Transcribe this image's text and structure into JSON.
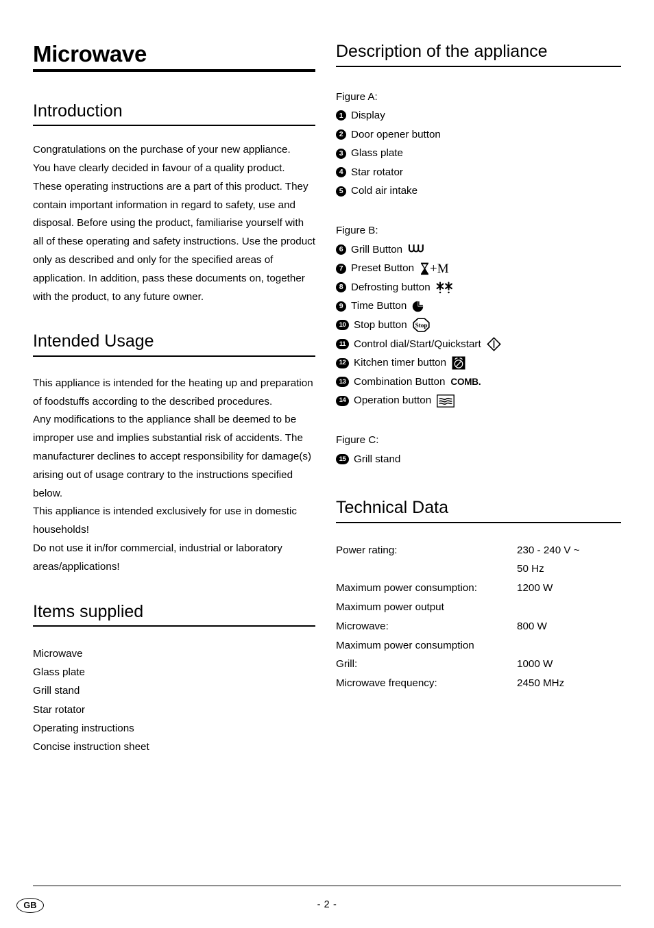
{
  "document": {
    "title": "Microwave"
  },
  "left_column": {
    "introduction": {
      "heading": "Introduction",
      "paragraphs": [
        "Congratulations on the purchase of your new appliance.",
        "You have clearly decided in favour of a quality product. These operating instructions are a part of this product. They contain important information in regard to safety, use and disposal. Before using the product, familiarise yourself with all of these operating and safety instructions. Use the product only as described and only for the specified areas of application. In addition, pass these documents on, together with the product, to any future owner."
      ]
    },
    "intended_usage": {
      "heading": "Intended Usage",
      "paragraphs": [
        "This appliance is intended for the heating up and preparation of foodstuffs according to the described procedures.",
        "Any modifications to the appliance shall be deemed to be improper use and implies substantial risk of accidents. The manufacturer declines to accept responsibility for damage(s) arising out of usage contrary to the instructions specified below.",
        "This appliance is intended exclusively for use in domestic households!",
        "Do not use it in/for commercial, industrial or laboratory areas/applications!"
      ]
    },
    "items_supplied": {
      "heading": "Items supplied",
      "items": [
        "Microwave",
        "Glass plate",
        "Grill stand",
        "Star rotator",
        "Operating instructions",
        "Concise instruction sheet"
      ]
    }
  },
  "right_column": {
    "description": {
      "heading": "Description of the appliance",
      "figure_a": {
        "label": "Figure A:",
        "items": [
          {
            "number": "1",
            "label": "Display",
            "icon": ""
          },
          {
            "number": "2",
            "label": "Door opener button",
            "icon": ""
          },
          {
            "number": "3",
            "label": "Glass plate",
            "icon": ""
          },
          {
            "number": "4",
            "label": "Star rotator",
            "icon": ""
          },
          {
            "number": "5",
            "label": "Cold air intake",
            "icon": ""
          }
        ]
      },
      "figure_b": {
        "label": "Figure B:",
        "items": [
          {
            "number": "6",
            "label": "Grill Button",
            "icon": "grill-element-icon"
          },
          {
            "number": "7",
            "label": "Preset Button",
            "icon": "hourglass-plus-m-icon"
          },
          {
            "number": "8",
            "label": "Defrosting button",
            "icon": "snowflake-pair-icon"
          },
          {
            "number": "9",
            "label": "Time Button",
            "icon": "pie-clock-icon"
          },
          {
            "number": "10",
            "label": "Stop button",
            "icon": "stop-octagon-icon"
          },
          {
            "number": "11",
            "label": "Control dial/Start/Quickstart",
            "icon": "diamond-start-icon"
          },
          {
            "number": "12",
            "label": "Kitchen timer button",
            "icon": "alarm-clock-icon"
          },
          {
            "number": "13",
            "label": "Combination Button",
            "icon": "comb-text-icon",
            "icon_text": "COMB."
          },
          {
            "number": "14",
            "label": "Operation button",
            "icon": "microwave-waves-icon"
          }
        ]
      },
      "figure_c": {
        "label": "Figure C:",
        "items": [
          {
            "number": "15",
            "label": "Grill stand",
            "icon": ""
          }
        ]
      }
    },
    "technical_data": {
      "heading": "Technical Data",
      "rows": [
        {
          "label": "Power rating:",
          "value": "230 - 240 V ~"
        },
        {
          "label": "",
          "value": "50 Hz"
        },
        {
          "label": "Maximum power consumption:",
          "value": "1200 W"
        },
        {
          "label": "Maximum power output",
          "value": ""
        },
        {
          "label": "Microwave:",
          "value": "800 W"
        },
        {
          "label": "Maximum power consumption",
          "value": ""
        },
        {
          "label": "Grill:",
          "value": "1000 W"
        },
        {
          "label": "Microwave frequency:",
          "value": "2450 MHz"
        }
      ]
    }
  },
  "footer": {
    "country_code": "GB",
    "page_number": "- 2 -"
  },
  "colors": {
    "ink": "#000000",
    "paper": "#ffffff"
  }
}
